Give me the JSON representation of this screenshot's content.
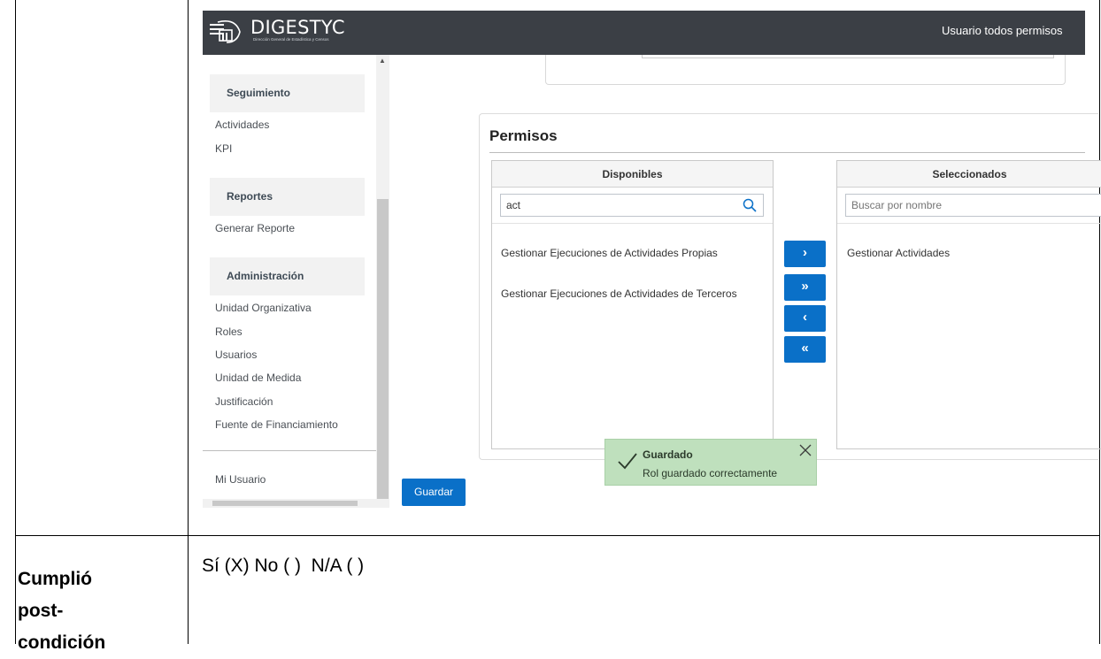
{
  "header": {
    "logo_text": "DIGESTYC",
    "logo_subtitle": "Dirección General de Estadística y Censos",
    "user_name": "Usuario todos permisos"
  },
  "sidebar": {
    "sections": [
      {
        "title": "Seguimiento",
        "items": [
          "Actividades",
          "KPI"
        ]
      },
      {
        "title": "Reportes",
        "items": [
          "Generar Reporte"
        ]
      },
      {
        "title": "Administración",
        "items": [
          "Unidad Organizativa",
          "Roles",
          "Usuarios",
          "Unidad de Medida",
          "Justificación",
          "Fuente de Financiamiento"
        ]
      }
    ],
    "footer_item": "Mi Usuario"
  },
  "permisos": {
    "title": "Permisos",
    "available": {
      "header": "Disponibles",
      "search_value": "act",
      "items": [
        "Gestionar Ejecuciones de Actividades Propias",
        "Gestionar Ejecuciones de Actividades de Terceros"
      ]
    },
    "selected": {
      "header": "Seleccionados",
      "search_placeholder": "Buscar por nombre",
      "items": [
        "Gestionar Actividades"
      ]
    },
    "buttons": {
      "move_one_right": "›",
      "move_all_right": "»",
      "move_one_left": "‹",
      "move_all_left": "«"
    }
  },
  "toast": {
    "title": "Guardado",
    "message": "Rol guardado correctamente"
  },
  "save_label": "Guardar",
  "document": {
    "label": [
      "Cumplió",
      "post-",
      "condición"
    ],
    "value": "Sí (X) No ( )  N/A ( )"
  },
  "colors": {
    "header_bg": "#3b3f45",
    "primary": "#0a70c8",
    "toast_bg": "#bfe0bd"
  }
}
